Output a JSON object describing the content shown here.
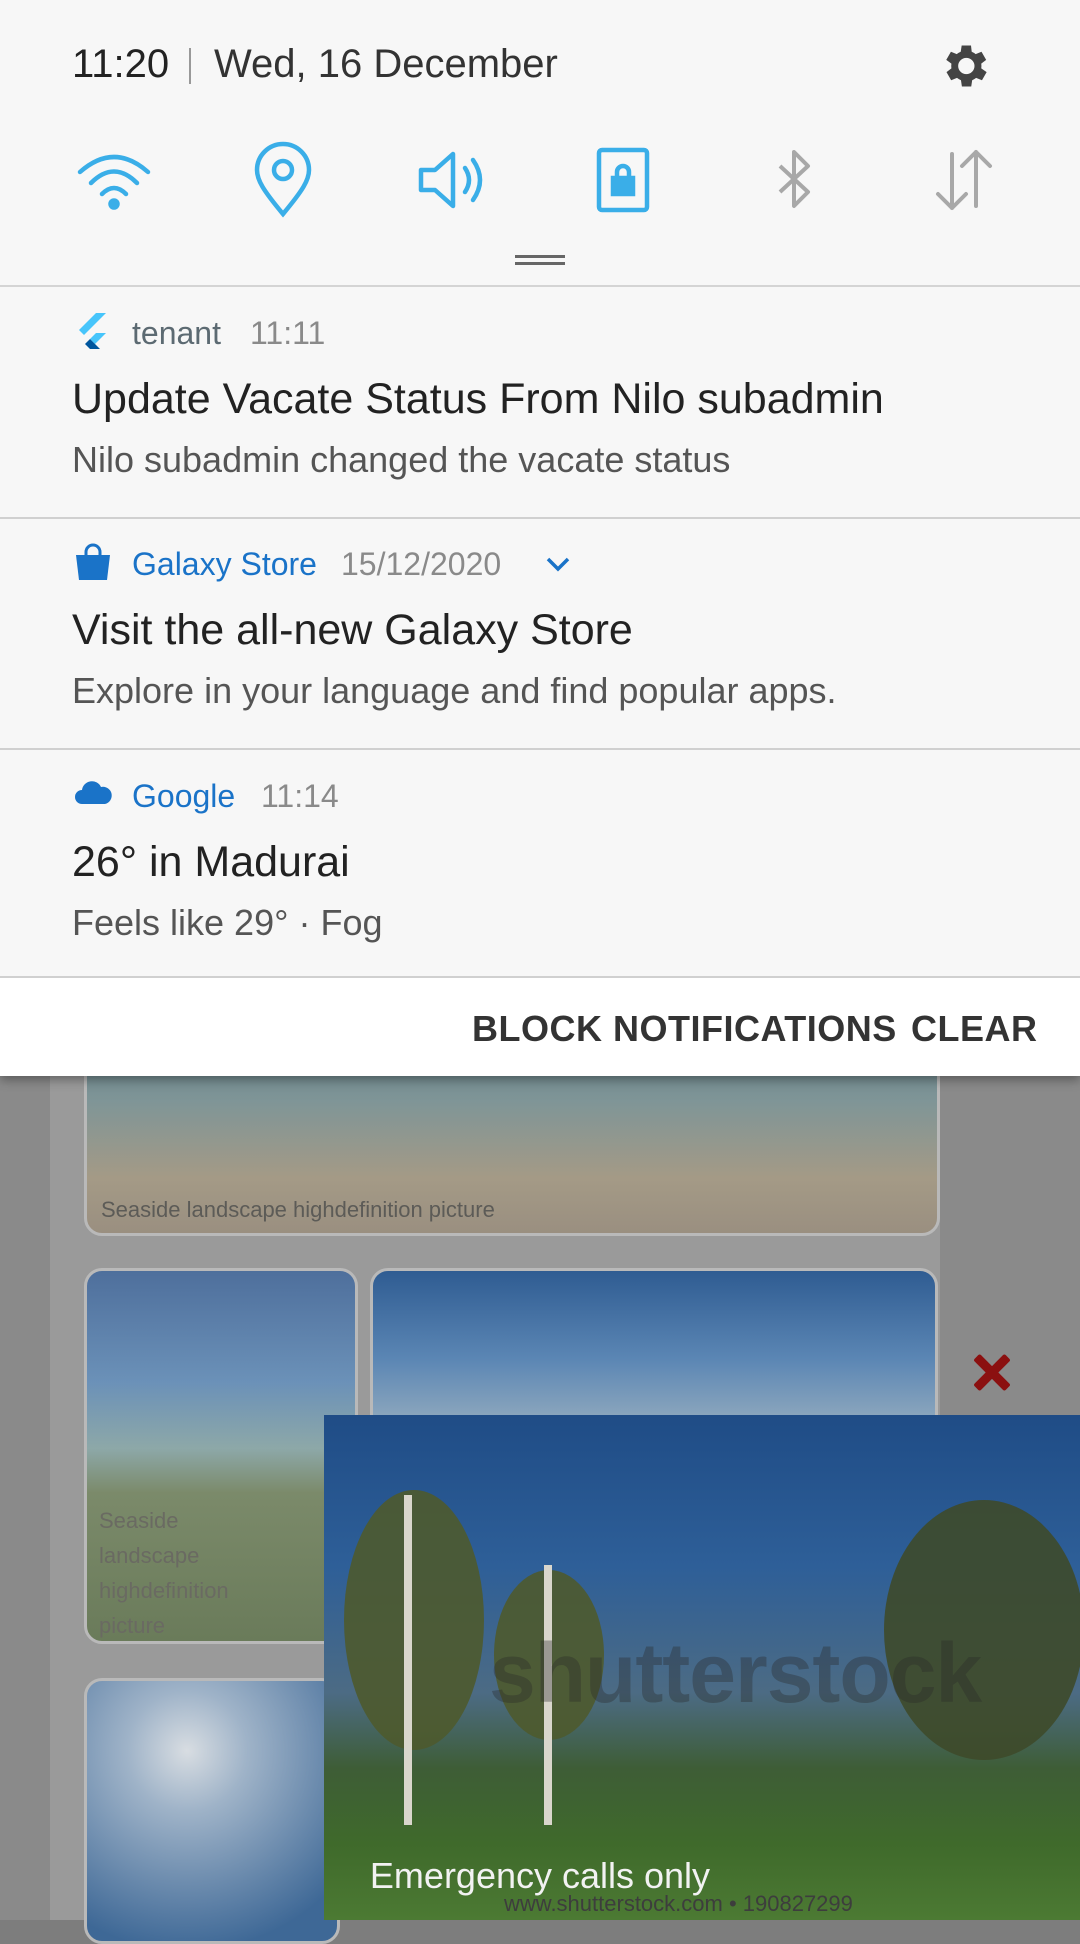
{
  "status": {
    "time": "11:20",
    "date": "Wed, 16 December"
  },
  "quick_settings": [
    {
      "name": "wifi",
      "state": "on",
      "icon": "wifi-icon"
    },
    {
      "name": "location",
      "state": "on",
      "icon": "location-icon"
    },
    {
      "name": "sound",
      "state": "on",
      "icon": "volume-icon"
    },
    {
      "name": "screen-rotation-lock",
      "state": "on",
      "icon": "portrait-lock-icon"
    },
    {
      "name": "bluetooth",
      "state": "off",
      "icon": "bluetooth-icon"
    },
    {
      "name": "mobile-data",
      "state": "off",
      "icon": "data-transfer-icon"
    }
  ],
  "notifications": [
    {
      "app": "tenant",
      "time": "11:11",
      "title": "Update Vacate Status From Nilo subadmin",
      "body": "Nilo subadmin changed the vacate status",
      "icon": "flutter-logo-icon"
    },
    {
      "app": "Galaxy Store",
      "time": "15/12/2020",
      "title": "Visit the all-new Galaxy Store",
      "body": "Explore in your language and find popular apps.",
      "icon": "shopping-bag-icon",
      "expandable": true
    },
    {
      "app": "Google",
      "time": "11:14",
      "title": "26° in Madurai",
      "body": "Feels like 29° · Fog",
      "icon": "cloud-icon"
    }
  ],
  "actions": {
    "block": "BLOCK NOTIFICATIONS",
    "clear": "CLEAR"
  },
  "background": {
    "card_caption_1": "Seaside landscape highdefinition picture",
    "card_caption_2": "Seaside landscape highdefinition picture",
    "watermark": "shutterstock",
    "watermark_url": "www.shutterstock.com • 190827299"
  },
  "footer": {
    "carrier_text": "Emergency calls only"
  },
  "colors": {
    "accent_on": "#3aaee8",
    "icon_off": "#a8a8a8",
    "link_blue": "#1a73c8"
  }
}
